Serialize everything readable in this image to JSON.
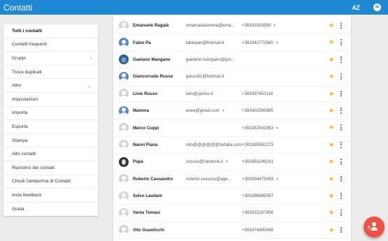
{
  "header": {
    "title": "Contatti",
    "sort_label": "AZ",
    "sort_icon": "sort-az-icon",
    "feedback_icon": "feedback-icon"
  },
  "sidebar": {
    "items": [
      {
        "label": "Tutti i contatti",
        "active": true
      },
      {
        "label": "Contatti frequenti"
      },
      {
        "label": "Gruppi",
        "expand": "›"
      },
      {
        "label": "Trova duplicati"
      },
      {
        "label": "Altro",
        "expand": "⌄"
      },
      {
        "label": "Impostazioni"
      },
      {
        "label": "Importa"
      },
      {
        "label": "Esporta"
      },
      {
        "label": "Stampa"
      },
      {
        "label": "Altri contatti"
      },
      {
        "label": "Ripristino dei contatti"
      },
      {
        "label": "Chiudi l'anteprima di Contatti"
      },
      {
        "label": "Invia feedback"
      },
      {
        "label": "Guida"
      }
    ]
  },
  "contacts": [
    {
      "name": "Emanuele Ragalà",
      "email": "emanuelaserena@ema...",
      "phone": "+39333333390",
      "phone_caret": true,
      "avatar": "gray"
    },
    {
      "name": "Fabio Pa",
      "email": "fabiopan@hotmail.it",
      "phone": "+393342772560",
      "phone_caret": true,
      "avatar": "blue"
    },
    {
      "name": "Gaetano Mangano",
      "email": "gaetano.mangano@gm...",
      "phone": "",
      "avatar": "photo"
    },
    {
      "name": "Giancorrado Russo",
      "email": "gasso91@hotmail.it",
      "phone": "",
      "avatar": "blue"
    },
    {
      "name": "Livio Russo",
      "email": "livio@yahoo.it",
      "phone": "+393397452116",
      "avatar": "gray"
    },
    {
      "name": "Mamma",
      "email": "evee@gmail.com",
      "email_caret": true,
      "phone": "+393402595985",
      "avatar": "blue"
    },
    {
      "name": "Marco Cuppi",
      "email": "",
      "phone": "+393382541563",
      "phone_caret": true,
      "avatar": "gray"
    },
    {
      "name": "Nanni Piana",
      "email": "info@@@@@@farfalla.com",
      "phone": "+393385592273",
      "avatar": "gray"
    },
    {
      "name": "Papà",
      "email": "cossso@randorie.it",
      "email_caret": true,
      "phone": "+393382249241",
      "avatar": "dark"
    },
    {
      "name": "Roberto Cassandro",
      "email": "roberto.xxxxxxx@age...",
      "phone": "+393394475083",
      "phone_caret": true,
      "avatar": "gray"
    },
    {
      "name": "Salvo Laudani",
      "email": "",
      "phone": "+393386889397",
      "avatar": "gray"
    },
    {
      "name": "Vania Tomasi",
      "email": "",
      "phone": "+393332167856",
      "avatar": "gray"
    },
    {
      "name": "Vito Guasticchi",
      "email": "",
      "phone": "+393474495686",
      "avatar": "gray"
    }
  ],
  "fab": {
    "icon": "add-contact-icon"
  },
  "colors": {
    "accent": "#1e88d5",
    "fab": "#f25042",
    "star": "#f4b400"
  }
}
